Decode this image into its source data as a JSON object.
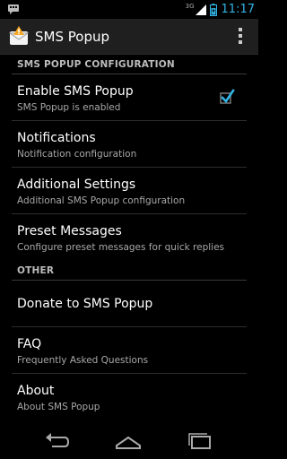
{
  "status_bar": {
    "network": "3G",
    "time": "11:17",
    "notification_icon": "sms-notification-icon",
    "accent_color": "#33b5e5"
  },
  "action_bar": {
    "title": "SMS Popup",
    "app_icon": "sms-popup-app-icon",
    "overflow_icon": "overflow-menu-icon"
  },
  "sections": [
    {
      "header": "SMS POPUP CONFIGURATION",
      "items": [
        {
          "title": "Enable SMS Popup",
          "summary": "SMS Popup is enabled",
          "checked": true
        },
        {
          "title": "Notifications",
          "summary": "Notification configuration"
        },
        {
          "title": "Additional Settings",
          "summary": "Additional SMS Popup configuration"
        },
        {
          "title": "Preset Messages",
          "summary": "Configure preset messages for quick replies"
        }
      ]
    },
    {
      "header": "OTHER",
      "items": [
        {
          "title": "Donate to SMS Popup"
        },
        {
          "title": "FAQ",
          "summary": "Frequently Asked Questions"
        },
        {
          "title": "About",
          "summary": "About SMS Popup"
        }
      ]
    }
  ],
  "nav_bar": {
    "back_icon": "back-icon",
    "home_icon": "home-icon",
    "recent_icon": "recent-apps-icon"
  }
}
